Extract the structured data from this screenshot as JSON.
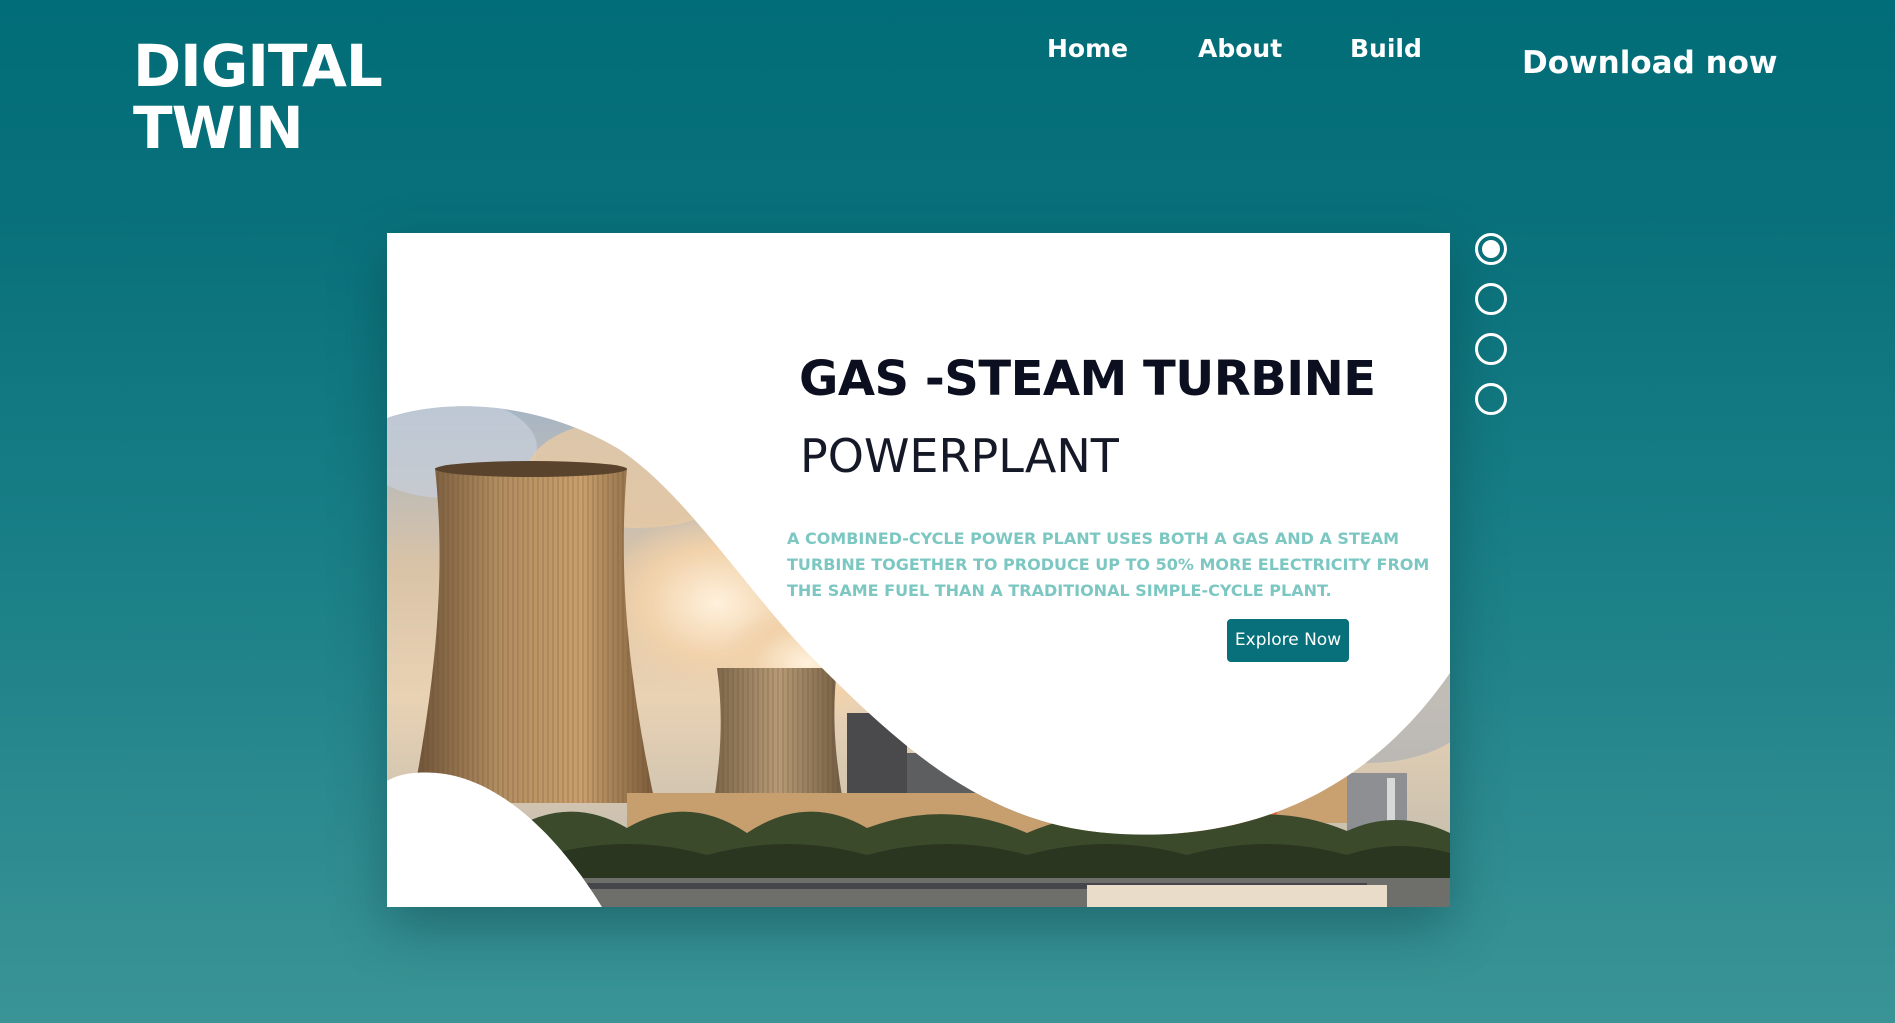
{
  "brand": {
    "line1": "DIGITAL",
    "line2": "TWIN"
  },
  "nav": {
    "items": [
      {
        "label": "Home"
      },
      {
        "label": "About"
      },
      {
        "label": "Build"
      }
    ],
    "cta_label": "Download now"
  },
  "hero": {
    "title": "GAS -STEAM TURBINE",
    "subtitle": "POWERPLANT",
    "description": "A COMBINED-CYCLE POWER PLANT USES BOTH A GAS AND A STEAM TURBINE TOGETHER TO PRODUCE UP TO 50% MORE ELECTRICITY FROM THE SAME FUEL THAN A TRADITIONAL SIMPLE-CYCLE PLANT.",
    "button_label": "Explore Now"
  },
  "slider": {
    "total_slides": 4,
    "active_index": 0
  },
  "colors": {
    "accent": "#08707a",
    "background_top": "#016d78",
    "background_bottom": "#3a9496",
    "description_text": "#7cc7c2",
    "heading_text": "#0c0f1f"
  }
}
